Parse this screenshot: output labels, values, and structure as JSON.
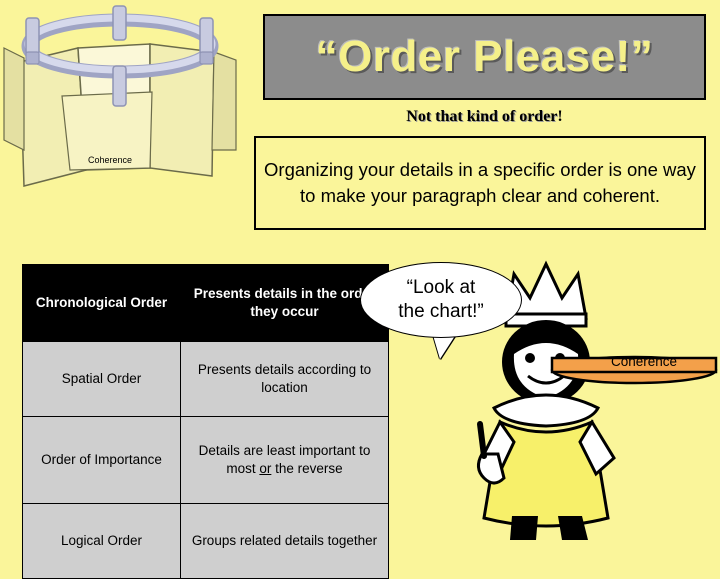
{
  "title": {
    "text": "“Order Please!”"
  },
  "subtitle": {
    "bold_part": "Not that kind of order",
    "end_part": "!"
  },
  "statement": {
    "text": "Organizing your details in a specific order is one way to make your paragraph clear and coherent."
  },
  "labels": {
    "coherence_left": "Coherence",
    "coherence_right": "Coherence"
  },
  "speech_bubble": {
    "line1": "“Look at",
    "line2": "the chart!”"
  },
  "table": {
    "rows": [
      {
        "order": "Chronological Order",
        "description": "Presents details in the order they occur",
        "header": true
      },
      {
        "order": "Spatial Order",
        "description": "Presents details according to location",
        "header": false
      },
      {
        "order": "Order of Importance",
        "description_pre": "Details are least important to most ",
        "description_underline": "or",
        "description_post": " the reverse",
        "header": false
      },
      {
        "order": "Logical Order",
        "description": "Groups related details together",
        "header": false
      }
    ]
  },
  "colors": {
    "page_background": "#FAF59A",
    "banner_fill": "#8C8C8C",
    "title_text": "#F5F08A",
    "table_header_bg": "#000000",
    "table_body_bg": "#CFCFCF",
    "folder_tab": "#F2EEB3",
    "rail_metal": "#C8CBE0"
  }
}
